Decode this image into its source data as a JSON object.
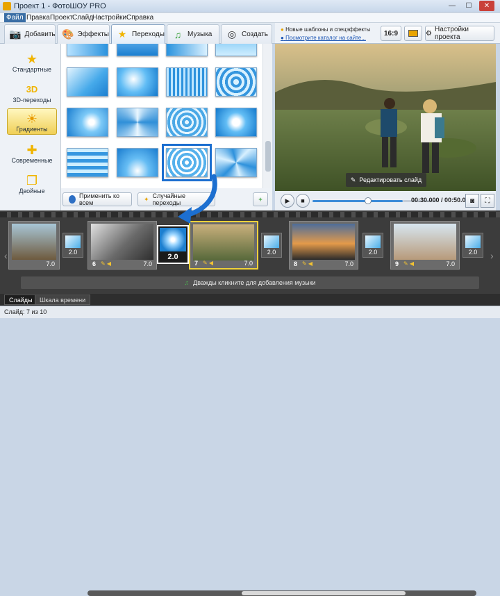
{
  "window": {
    "title": "Проект 1 - ФотоШОУ PRO",
    "minimize": "—",
    "maximize": "☐",
    "close": "✕"
  },
  "menu": [
    "Файл",
    "Правка",
    "Проект",
    "Слайд",
    "Настройки",
    "Справка"
  ],
  "tabs": [
    {
      "label": "Добавить",
      "icon": "camera-icon"
    },
    {
      "label": "Эффекты",
      "icon": "palette-icon"
    },
    {
      "label": "Переходы",
      "icon": "star-icon"
    },
    {
      "label": "Музыка",
      "icon": "music-note-icon"
    },
    {
      "label": "Создать",
      "icon": "film-reel-icon"
    }
  ],
  "news": {
    "line1": "Новые шаблоны и спецэффекты",
    "line2": "Посмотрите каталог на сайте..."
  },
  "right_toolbar": {
    "ratio_label": "16:9",
    "settings_label": "Настройки проекта"
  },
  "categories": [
    {
      "label": "Стандартные",
      "icon": "star-icon"
    },
    {
      "label": "3D-переходы",
      "icon": "3d-icon"
    },
    {
      "label": "Градиенты",
      "icon": "sun-icon"
    },
    {
      "label": "Современные",
      "icon": "puzzle-icon"
    },
    {
      "label": "Двойные",
      "icon": "double-icon"
    }
  ],
  "grid_actions": {
    "apply_all": "Применить ко всем",
    "random": "Случайные переходы"
  },
  "preview": {
    "edit_label": "Редактировать слайд"
  },
  "player": {
    "time": "00:30.000 / 00:50.000",
    "progress_fraction": 0.6
  },
  "timeline": {
    "slides": [
      {
        "num": "",
        "duration": "7.0"
      },
      {
        "num": "6",
        "duration": "7.0"
      },
      {
        "num": "7",
        "duration": "7.0"
      },
      {
        "num": "8",
        "duration": "7.0"
      },
      {
        "num": "9",
        "duration": "7.0"
      }
    ],
    "transitions": [
      "2.0",
      "2.0",
      "2.0",
      "2.0"
    ],
    "dragged_transition": "2.0",
    "music_hint": "Дважды кликните для добавления музыки"
  },
  "bottom_tabs": {
    "slides": "Слайды",
    "timeline": "Шкала времени"
  },
  "status": "Слайд: 7 из 10",
  "colors": {
    "accent": "#1c6fd0",
    "selected_slide": "#f0d23a"
  }
}
